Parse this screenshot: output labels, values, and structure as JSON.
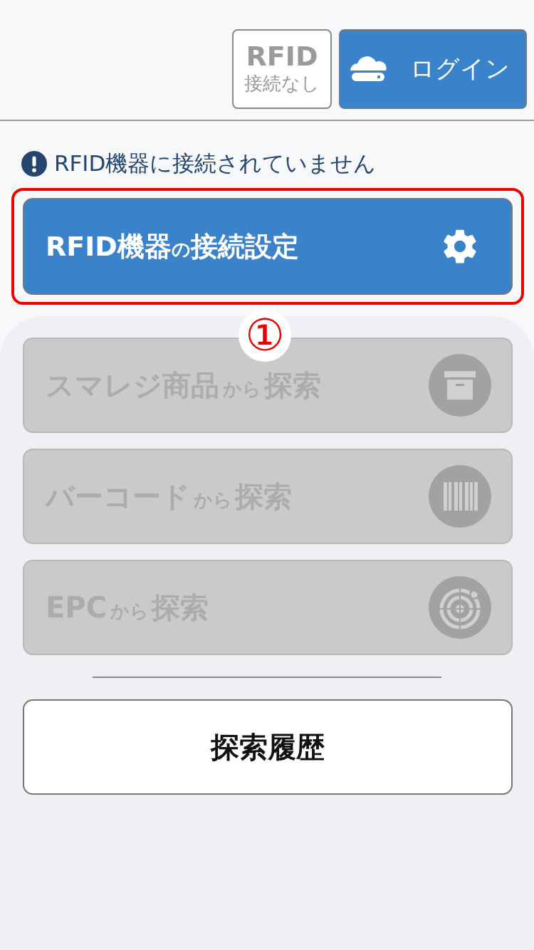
{
  "header": {
    "rfid_status": {
      "title": "RFID",
      "status": "接続なし",
      "connected": false
    },
    "login_button": {
      "label": "ログイン"
    }
  },
  "notice": {
    "text": "RFID機器に接続されていません"
  },
  "settings_button": {
    "parts": [
      "RFID機器",
      "の",
      "接続設定"
    ],
    "highlighted": true
  },
  "annotation": {
    "label": "①"
  },
  "search_buttons": [
    {
      "kind": "product",
      "source": "スマレジ商品",
      "connector": "から",
      "action": "探索",
      "disabled": true
    },
    {
      "kind": "barcode",
      "source": "バーコード",
      "connector": "から",
      "action": "探索",
      "disabled": true
    },
    {
      "kind": "epc",
      "source": "EPC",
      "connector": "から",
      "action": "探索",
      "disabled": true
    }
  ],
  "history_button": {
    "label": "探索履歴"
  }
}
